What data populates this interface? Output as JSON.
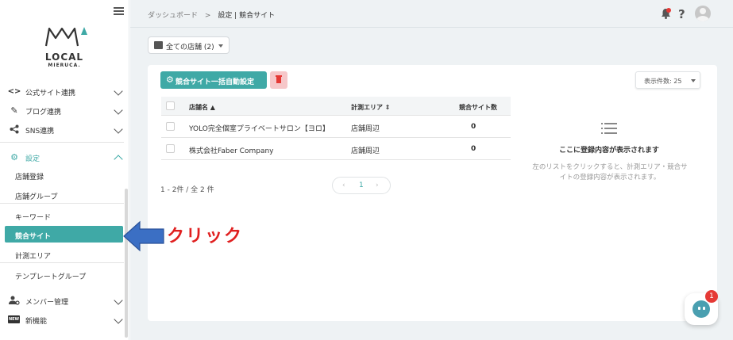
{
  "sidebar": {
    "logo": {
      "text": "LOCAL",
      "subtext": "MIERUCA."
    },
    "items": [
      {
        "label": "公式サイト連携"
      },
      {
        "label": "ブログ連携"
      },
      {
        "label": "SNS連携"
      },
      {
        "label": "設定"
      },
      {
        "label": "メンバー管理"
      },
      {
        "label": "新機能"
      }
    ],
    "settings_sub": [
      {
        "label": "店舗登録"
      },
      {
        "label": "店舗グループ"
      },
      {
        "label": "キーワード"
      },
      {
        "label": "競合サイト"
      },
      {
        "label": "計測エリア"
      },
      {
        "label": "テンプレートグループ"
      }
    ],
    "new_badge": "NEW"
  },
  "header": {
    "breadcrumb": {
      "home": "ダッシュボード",
      "sep": ">",
      "current": "設定 | 競合サイト"
    },
    "help": "?"
  },
  "store_select": {
    "label": "全ての店舗 (2)"
  },
  "toolbar": {
    "auto_setting_label": "競合サイト一括自動設定",
    "per_page_label": "表示件数: 25"
  },
  "table": {
    "headers": [
      "店舗名",
      "計測エリア",
      "競合サイト数"
    ],
    "rows": [
      {
        "name": "YOLO完全個室プライベートサロン【ヨロ】",
        "area": "店舗周辺",
        "count": "0"
      },
      {
        "name": "株式会社Faber Company",
        "area": "店舗周辺",
        "count": "0"
      }
    ]
  },
  "footer": {
    "count_text": "1 - 2件 / 全 2 件",
    "current_page": "1"
  },
  "empty_state": {
    "title": "ここに登録内容が表示されます",
    "description": "左のリストをクリックすると、計測エリア・競合サイトの登録内容が表示されます。"
  },
  "chat": {
    "badge": "1"
  },
  "annotation": {
    "text": "クリック"
  },
  "colors": {
    "accent": "#3fa9a6",
    "danger": "#e53935",
    "callout": "#e02020",
    "arrow": "#3b6fc4"
  }
}
